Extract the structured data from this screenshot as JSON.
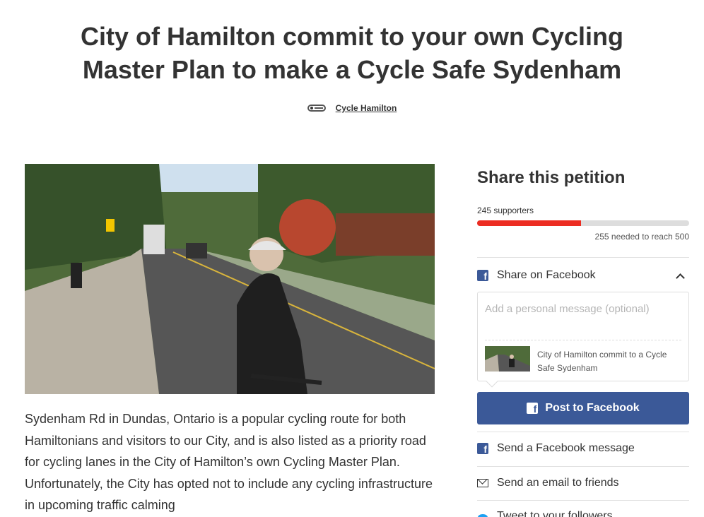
{
  "petition": {
    "title": "City of Hamilton commit to your own Cycling Master Plan to make a Cycle Safe Sydenham",
    "author": "Cycle Hamilton",
    "body": "Sydenham Rd in Dundas, Ontario is a popular cycling route for both Hamiltonians and visitors to our City, and is also listed as a priority road for cycling lanes in the City of Hamilton’s own Cycling Master Plan. Unfortunately, the City has opted not to include any cycling infrastructure in upcoming traffic calming"
  },
  "sidebar": {
    "share_title": "Share this petition",
    "supporters_text": "245 supporters",
    "progress_fraction": 0.49,
    "needed_text": "255 needed to reach 500",
    "share_facebook_label": "Share on Facebook",
    "message_placeholder": "Add a personal message (optional)",
    "preview_title": "City of Hamilton commit to a Cycle Safe Sydenham",
    "post_button_label": "Post to Facebook",
    "fb_message_label": "Send a Facebook message",
    "email_label": "Send an email to friends",
    "tweet_label": "Tweet to your followers"
  },
  "colors": {
    "progress": "#ec2c22",
    "facebook": "#3b5998",
    "twitter": "#1da1f2"
  },
  "icons": [
    "cycle-hamilton-logo",
    "facebook-icon",
    "chevron-up-icon",
    "mail-icon",
    "twitter-icon"
  ]
}
